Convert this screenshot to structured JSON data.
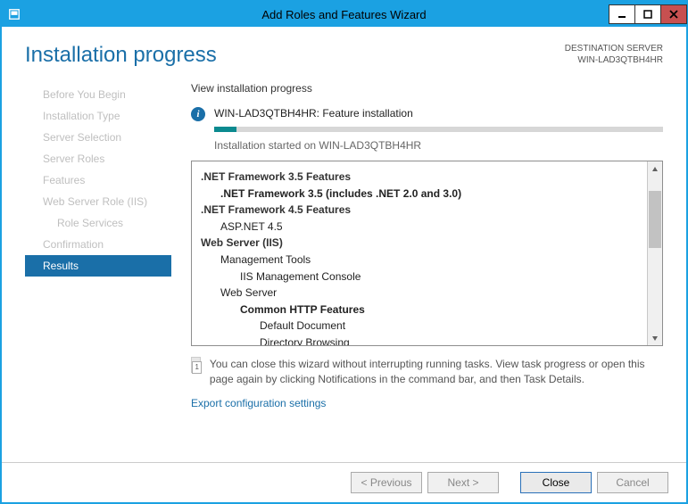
{
  "window": {
    "title": "Add Roles and Features Wizard"
  },
  "header": {
    "page_title": "Installation progress",
    "dest_label": "DESTINATION SERVER",
    "dest_value": "WIN-LAD3QTBH4HR"
  },
  "sidebar": {
    "items": [
      {
        "label": "Before You Begin"
      },
      {
        "label": "Installation Type"
      },
      {
        "label": "Server Selection"
      },
      {
        "label": "Server Roles"
      },
      {
        "label": "Features"
      },
      {
        "label": "Web Server Role (IIS)"
      },
      {
        "label": "Role Services",
        "indent": true
      },
      {
        "label": "Confirmation"
      },
      {
        "label": "Results",
        "active": true
      }
    ]
  },
  "main": {
    "heading": "View installation progress",
    "status_line": "WIN-LAD3QTBH4HR: Feature installation",
    "progress_percent": 5,
    "started_line": "Installation started on WIN-LAD3QTBH4HR",
    "features": [
      {
        "text": ".NET Framework 3.5 Features",
        "level": 0,
        "bold": true
      },
      {
        "text": ".NET Framework 3.5 (includes .NET 2.0 and 3.0)",
        "level": 1,
        "bold": true
      },
      {
        "text": ".NET Framework 4.5 Features",
        "level": 0,
        "bold": true
      },
      {
        "text": "ASP.NET 4.5",
        "level": 1
      },
      {
        "text": "Web Server (IIS)",
        "level": 0
      },
      {
        "text": "Management Tools",
        "level": 1
      },
      {
        "text": "IIS Management Console",
        "level": 2
      },
      {
        "text": "Web Server",
        "level": 1
      },
      {
        "text": "Common HTTP Features",
        "level": 2,
        "bold": true
      },
      {
        "text": "Default Document",
        "level": 3
      },
      {
        "text": "Directory Browsing",
        "level": 3
      }
    ],
    "note": "You can close this wizard without interrupting running tasks. View task progress or open this page again by clicking Notifications in the command bar, and then Task Details.",
    "export_link": "Export configuration settings"
  },
  "footer": {
    "previous": "< Previous",
    "next": "Next >",
    "close": "Close",
    "cancel": "Cancel"
  }
}
